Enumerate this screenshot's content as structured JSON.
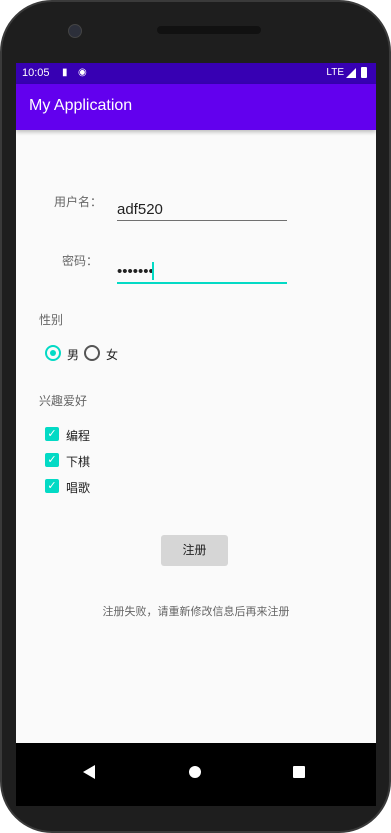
{
  "status_bar": {
    "time": "10:05",
    "network": "LTE",
    "icons": [
      "sd-card-icon",
      "sync-icon",
      "signal-icon",
      "battery-icon"
    ]
  },
  "app_bar": {
    "title": "My Application"
  },
  "form": {
    "username_label": "用户名：",
    "username_value": "adf520",
    "password_label": "密码：",
    "password_value": "•••••••",
    "gender_label": "性别",
    "gender_options": [
      {
        "label": "男",
        "checked": true
      },
      {
        "label": "女",
        "checked": false
      }
    ],
    "hobby_label": "兴趣爱好",
    "hobbies": [
      {
        "label": "编程",
        "checked": true
      },
      {
        "label": "下棋",
        "checked": true
      },
      {
        "label": "唱歌",
        "checked": true
      }
    ],
    "register_label": "注册",
    "message": "注册失败，请重新修改信息后再来注册"
  },
  "colors": {
    "primary": "#6200ee",
    "primary_dark": "#3700b3",
    "accent": "#03dac5"
  }
}
